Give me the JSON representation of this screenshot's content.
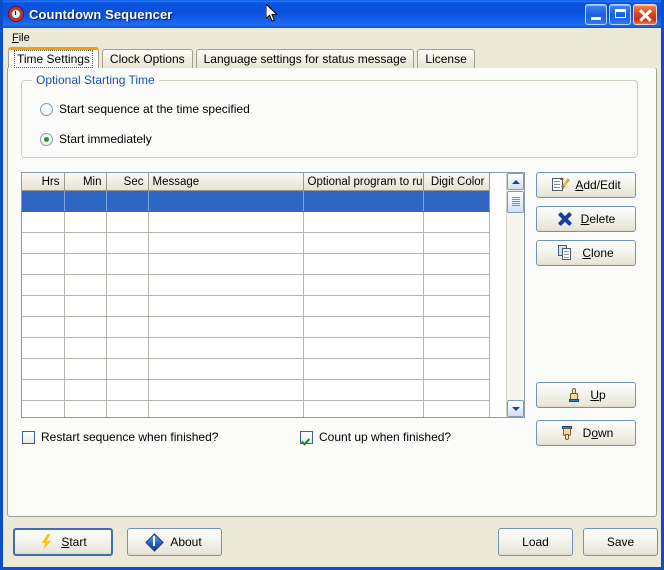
{
  "window": {
    "title": "Countdown Sequencer",
    "icon": "alarm-clock-icon",
    "minimize_label": "Minimize",
    "maximize_label": "Maximize",
    "close_label": "Close"
  },
  "menu": {
    "items": [
      {
        "label": "File",
        "accel": "F"
      }
    ]
  },
  "tabs": [
    {
      "label": "Time Settings",
      "active": true
    },
    {
      "label": "Clock Options",
      "active": false
    },
    {
      "label": "Language settings for status message",
      "active": false
    },
    {
      "label": "License",
      "active": false
    }
  ],
  "group": {
    "title": "Optional Starting Time",
    "options": [
      {
        "label": "Start sequence at the time specified",
        "selected": false
      },
      {
        "label": "Start immediately",
        "selected": true
      }
    ]
  },
  "grid": {
    "columns": [
      {
        "label": "Hrs",
        "align": "right"
      },
      {
        "label": "Min",
        "align": "right"
      },
      {
        "label": "Sec",
        "align": "right"
      },
      {
        "label": "Message",
        "align": "left"
      },
      {
        "label": "Optional program to run",
        "align": "left"
      },
      {
        "label": "Digit Color",
        "align": "right"
      }
    ],
    "rows": [
      {
        "selected": true,
        "cells": [
          "",
          "",
          "",
          "",
          "",
          ""
        ]
      },
      {
        "selected": false,
        "cells": [
          "",
          "",
          "",
          "",
          "",
          ""
        ]
      },
      {
        "selected": false,
        "cells": [
          "",
          "",
          "",
          "",
          "",
          ""
        ]
      },
      {
        "selected": false,
        "cells": [
          "",
          "",
          "",
          "",
          "",
          ""
        ]
      },
      {
        "selected": false,
        "cells": [
          "",
          "",
          "",
          "",
          "",
          ""
        ]
      },
      {
        "selected": false,
        "cells": [
          "",
          "",
          "",
          "",
          "",
          ""
        ]
      },
      {
        "selected": false,
        "cells": [
          "",
          "",
          "",
          "",
          "",
          ""
        ]
      },
      {
        "selected": false,
        "cells": [
          "",
          "",
          "",
          "",
          "",
          ""
        ]
      },
      {
        "selected": false,
        "cells": [
          "",
          "",
          "",
          "",
          "",
          ""
        ]
      },
      {
        "selected": false,
        "cells": [
          "",
          "",
          "",
          "",
          "",
          ""
        ]
      },
      {
        "selected": false,
        "cells": [
          "",
          "",
          "",
          "",
          "",
          ""
        ]
      }
    ],
    "selection_color": "#2f66c4"
  },
  "side_buttons": [
    {
      "label_pre": "",
      "accel": "A",
      "label_post": "dd/Edit",
      "icon": "note-pencil-icon"
    },
    {
      "label_pre": "",
      "accel": "D",
      "label_post": "elete",
      "icon": "blue-x-icon"
    },
    {
      "label_pre": "",
      "accel": "C",
      "label_post": "lone",
      "icon": "copy-icon"
    },
    {
      "label_pre": "",
      "accel": "U",
      "label_post": "p",
      "icon": "hand-up-icon"
    },
    {
      "label_pre": "D",
      "accel": "o",
      "label_post": "wn",
      "icon": "hand-down-icon"
    }
  ],
  "checkboxes": [
    {
      "label": "Restart sequence when finished?",
      "checked": false
    },
    {
      "label": "Count up when finished?",
      "checked": true
    }
  ],
  "bottom_buttons": [
    {
      "label_pre": "",
      "accel": "S",
      "label_post": "tart",
      "icon": "lightning-bolt-icon",
      "default": true
    },
    {
      "label_pre": "About",
      "accel": "",
      "label_post": "",
      "icon": "info-diamond-icon",
      "default": false
    },
    {
      "label_pre": "Load",
      "accel": "",
      "label_post": "",
      "icon": "",
      "default": false
    },
    {
      "label_pre": "Save",
      "accel": "",
      "label_post": "",
      "icon": "",
      "default": false
    }
  ],
  "colors": {
    "titlebar_blue": "#0a54e0",
    "window_border": "#0b4fc8",
    "face": "#ece9d8",
    "group_title_blue": "#1b52b0",
    "active_tab_accent": "#f0a000",
    "selection": "#2f66c4",
    "check_green": "#148a22"
  }
}
